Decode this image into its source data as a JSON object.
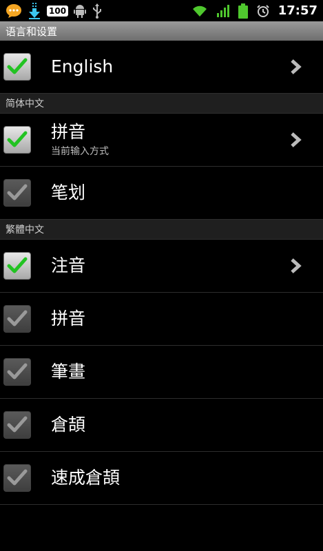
{
  "status_bar": {
    "battery_badge": "100",
    "time": "17:57",
    "icons": [
      "chat-bubble-icon",
      "download-icon",
      "android-icon",
      "usb-icon",
      "wifi-icon",
      "signal-icon",
      "battery-icon",
      "alarm-icon"
    ]
  },
  "title": "语言和设置",
  "rows_top": [
    {
      "label": "English",
      "checked": true,
      "has_more": true
    }
  ],
  "sections": {
    "simplified": "简体中文",
    "traditional": "繁體中文"
  },
  "simplified_items": [
    {
      "label": "拼音",
      "sublabel": "当前输入方式",
      "checked": true,
      "has_more": true
    },
    {
      "label": "笔划",
      "checked": false,
      "has_more": false
    }
  ],
  "traditional_items": [
    {
      "label": "注音",
      "checked": true,
      "has_more": true
    },
    {
      "label": "拼音",
      "checked": false,
      "has_more": false
    },
    {
      "label": "筆畫",
      "checked": false,
      "has_more": false
    },
    {
      "label": "倉頡",
      "checked": false,
      "has_more": false
    },
    {
      "label": "速成倉頡",
      "checked": false,
      "has_more": false
    }
  ],
  "colors": {
    "check_on": "#22c322",
    "check_off": "#9a9a9a",
    "title_bar": "#8a8a8a",
    "section_bg": "#1f1f1f"
  }
}
